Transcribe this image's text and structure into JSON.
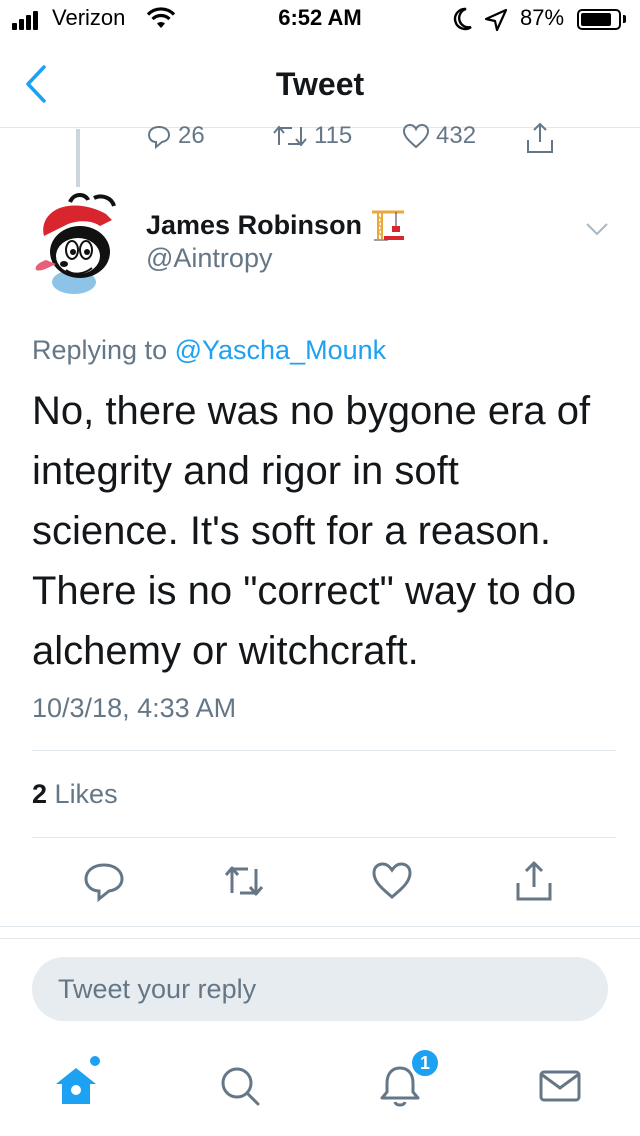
{
  "status_bar": {
    "carrier": "Verizon",
    "time": "6:52 AM",
    "battery_percent": "87%"
  },
  "nav": {
    "title": "Tweet"
  },
  "previous_tweet": {
    "replies": "26",
    "retweets": "115",
    "likes": "432"
  },
  "tweet": {
    "author_name": "James Robinson",
    "author_handle": "@Aintropy",
    "replying_prefix": "Replying to",
    "replying_to": "@Yascha_Mounk",
    "text": "No, there was no bygone era of integrity and rigor in soft science. It's soft for a reason. There is no \"correct\" way to do alchemy or witchcraft.",
    "timestamp": "10/3/18, 4:33 AM",
    "likes_count": "2",
    "likes_label": "Likes"
  },
  "reply": {
    "placeholder": "Tweet your reply"
  },
  "tabbar": {
    "notifications_badge": "1"
  },
  "colors": {
    "accent": "#1da1f2",
    "secondary_text": "#657786",
    "primary_text": "#14171a",
    "divider": "#e1e8ed"
  },
  "icons": [
    "signal-icon",
    "wifi-icon",
    "moon-icon",
    "location-icon",
    "battery-icon",
    "back-chevron-icon",
    "reply-icon",
    "retweet-icon",
    "like-icon",
    "share-icon",
    "crane-emoji-icon",
    "caret-down-icon",
    "home-icon",
    "search-icon",
    "notifications-icon",
    "messages-icon"
  ]
}
